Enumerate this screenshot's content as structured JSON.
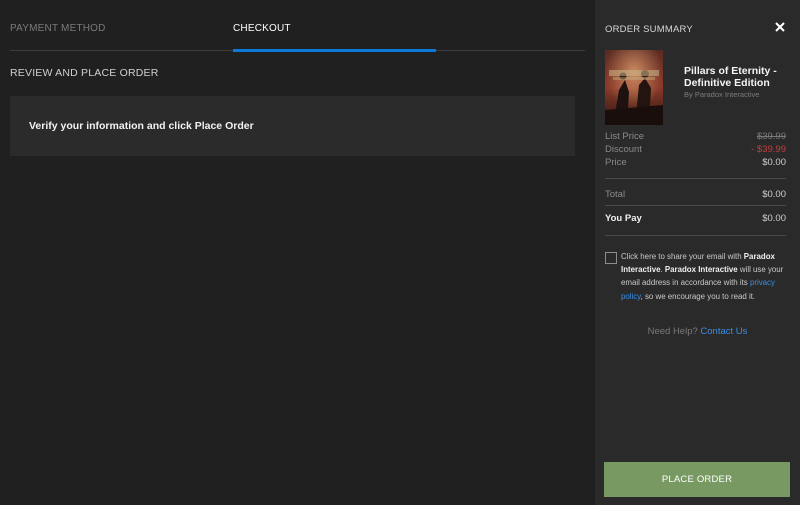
{
  "tabs": {
    "payment_method": "PAYMENT METHOD",
    "checkout": "CHECKOUT"
  },
  "main": {
    "section_title": "REVIEW AND PLACE ORDER",
    "info_message": "Verify your information and click Place Order"
  },
  "summary": {
    "title": "ORDER SUMMARY",
    "product": {
      "name": "Pillars of Eternity - Definitive Edition",
      "publisher": "By Paradox Interactive"
    },
    "list_price_label": "List Price",
    "list_price_value": "$39.99",
    "discount_label": "Discount",
    "discount_value": "- $39.99",
    "price_label": "Price",
    "price_value": "$0.00",
    "total_label": "Total",
    "total_value": "$0.00",
    "you_pay_label": "You Pay",
    "you_pay_value": "$0.00",
    "consent": {
      "text_1": "Click here to share your email with ",
      "company_1": "Paradox Interactive",
      "text_2": ". ",
      "company_2": "Paradox Interactive",
      "text_3": " will use your email address in accordance with its ",
      "privacy_link": "privacy policy",
      "text_4": ", so we encourage you to read it."
    },
    "help_text": "Need Help?",
    "contact_link": "Contact Us",
    "place_order_label": "PLACE ORDER"
  },
  "colors": {
    "background": "#202020",
    "panel": "#2a2a2a",
    "accent_blue": "#0c79d8",
    "place_order_green": "#789a62",
    "discount_red": "#c43c3c",
    "link_blue": "#3a8ee6"
  },
  "icons": {
    "close": "close-icon"
  }
}
